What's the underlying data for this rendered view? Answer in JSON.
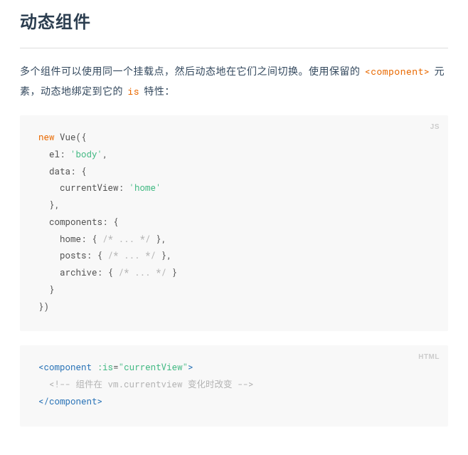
{
  "heading": "动态组件",
  "intro": {
    "part1": "多个组件可以使用同一个挂载点，然后动态地在它们之间切换。使用保留的 ",
    "code1": "<component>",
    "part2": " 元素，动态地绑定到它的 ",
    "code2": "is",
    "part3": " 特性："
  },
  "block1": {
    "lang": "JS",
    "tokens": {
      "kw_new": "new",
      "vue": " Vue({",
      "el_key": "  el: ",
      "el_val": "'body'",
      "comma1": ",",
      "data_open": "  data: {",
      "cv_key": "    currentView: ",
      "cv_val": "'home'",
      "data_close": "  },",
      "comp_open": "  components: {",
      "home_key": "    home: { ",
      "home_cm": "/* ... */",
      "home_end": " },",
      "posts_key": "    posts: { ",
      "posts_cm": "/* ... */",
      "posts_end": " },",
      "archive_key": "    archive: { ",
      "archive_cm": "/* ... */",
      "archive_end": " }",
      "comp_close": "  }",
      "close": "})"
    }
  },
  "block2": {
    "lang": "HTML",
    "tokens": {
      "open_lt": "<",
      "open_tag": "component",
      "sp": " ",
      "attr_is": ":is",
      "eq": "=",
      "attr_val": "\"currentView\"",
      "open_gt": ">",
      "comment": "  <!-- 组件在 vm.currentview 变化时改变 -->",
      "close_lt": "</",
      "close_tag": "component",
      "close_gt": ">"
    }
  }
}
